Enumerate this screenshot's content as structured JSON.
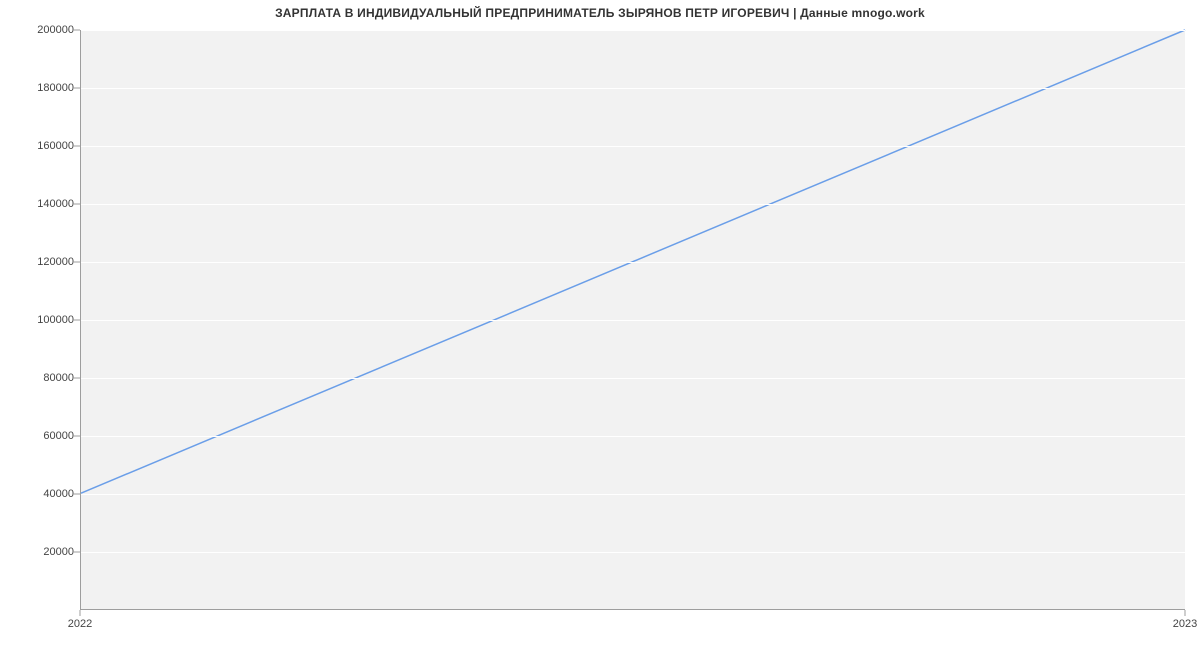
{
  "chart_data": {
    "type": "line",
    "title": "ЗАРПЛАТА В ИНДИВИДУАЛЬНЫЙ ПРЕДПРИНИМАТЕЛЬ ЗЫРЯНОВ ПЕТР ИГОРЕВИЧ | Данные mnogo.work",
    "x": [
      2022,
      2023
    ],
    "values": [
      40000,
      200000
    ],
    "x_ticks": [
      2022,
      2023
    ],
    "y_ticks": [
      20000,
      40000,
      60000,
      80000,
      100000,
      120000,
      140000,
      160000,
      180000,
      200000
    ],
    "xlabel": "",
    "ylabel": "",
    "xlim": [
      2022,
      2023
    ],
    "ylim": [
      0,
      200000
    ],
    "line_color": "#6a9ee8",
    "plot_bg": "#f2f2f2",
    "grid_color": "#ffffff"
  }
}
